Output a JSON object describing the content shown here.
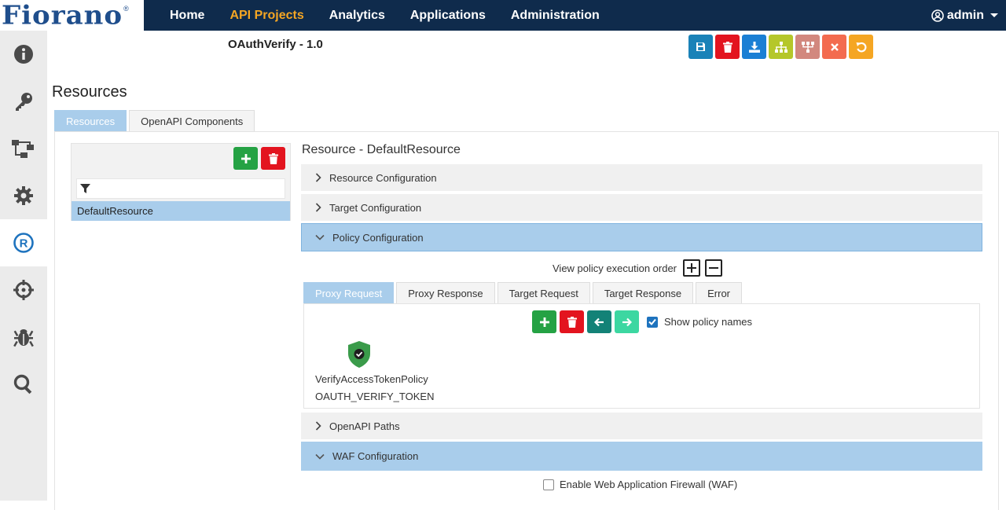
{
  "brand": {
    "logo_text": "Fiorano",
    "reg": "®"
  },
  "nav": {
    "items": [
      {
        "label": "Home",
        "active": false
      },
      {
        "label": "API Projects",
        "active": true
      },
      {
        "label": "Analytics",
        "active": false
      },
      {
        "label": "Applications",
        "active": false
      },
      {
        "label": "Administration",
        "active": false
      }
    ],
    "user": "admin"
  },
  "sidebar": {
    "items": [
      {
        "icon": "info-icon"
      },
      {
        "icon": "key-icon"
      },
      {
        "icon": "flow-icon"
      },
      {
        "icon": "gear-icon"
      },
      {
        "icon": "registered-icon",
        "active": true
      },
      {
        "icon": "crosshair-icon"
      },
      {
        "icon": "bug-icon"
      },
      {
        "icon": "search-icon"
      }
    ]
  },
  "project": {
    "title": "OAuthVerify - 1.0"
  },
  "toolbar": {
    "colors": {
      "save": "#1a82b8",
      "delete": "#e3141f",
      "download": "#1a7fd4",
      "hierarchy": "#b5c72a",
      "deploy": "#d2887e",
      "close": "#f36b4f",
      "undo": "#f5a623"
    }
  },
  "section": {
    "title": "Resources"
  },
  "tabs": [
    {
      "label": "Resources",
      "active": true
    },
    {
      "label": "OpenAPI Components",
      "active": false
    }
  ],
  "resources": {
    "items": [
      {
        "name": "DefaultResource",
        "selected": true
      }
    ]
  },
  "resource_detail": {
    "title": "Resource - DefaultResource",
    "accordions": {
      "resource_config": "Resource Configuration",
      "target_config": "Target Configuration",
      "policy_config": "Policy Configuration",
      "openapi_paths": "OpenAPI Paths",
      "waf_config": "WAF Configuration"
    }
  },
  "policy": {
    "exec_order_label": "View policy execution order",
    "tabs": [
      {
        "label": "Proxy Request",
        "active": true
      },
      {
        "label": "Proxy Response",
        "active": false
      },
      {
        "label": "Target Request",
        "active": false
      },
      {
        "label": "Target Response",
        "active": false
      },
      {
        "label": "Error",
        "active": false
      }
    ],
    "show_names_label": "Show policy names",
    "show_names_checked": true,
    "items": [
      {
        "name": "VerifyAccessTokenPolicy",
        "type": "OAUTH_VERIFY_TOKEN"
      }
    ]
  },
  "waf": {
    "label": "Enable Web Application Firewall (WAF)",
    "checked": false
  }
}
